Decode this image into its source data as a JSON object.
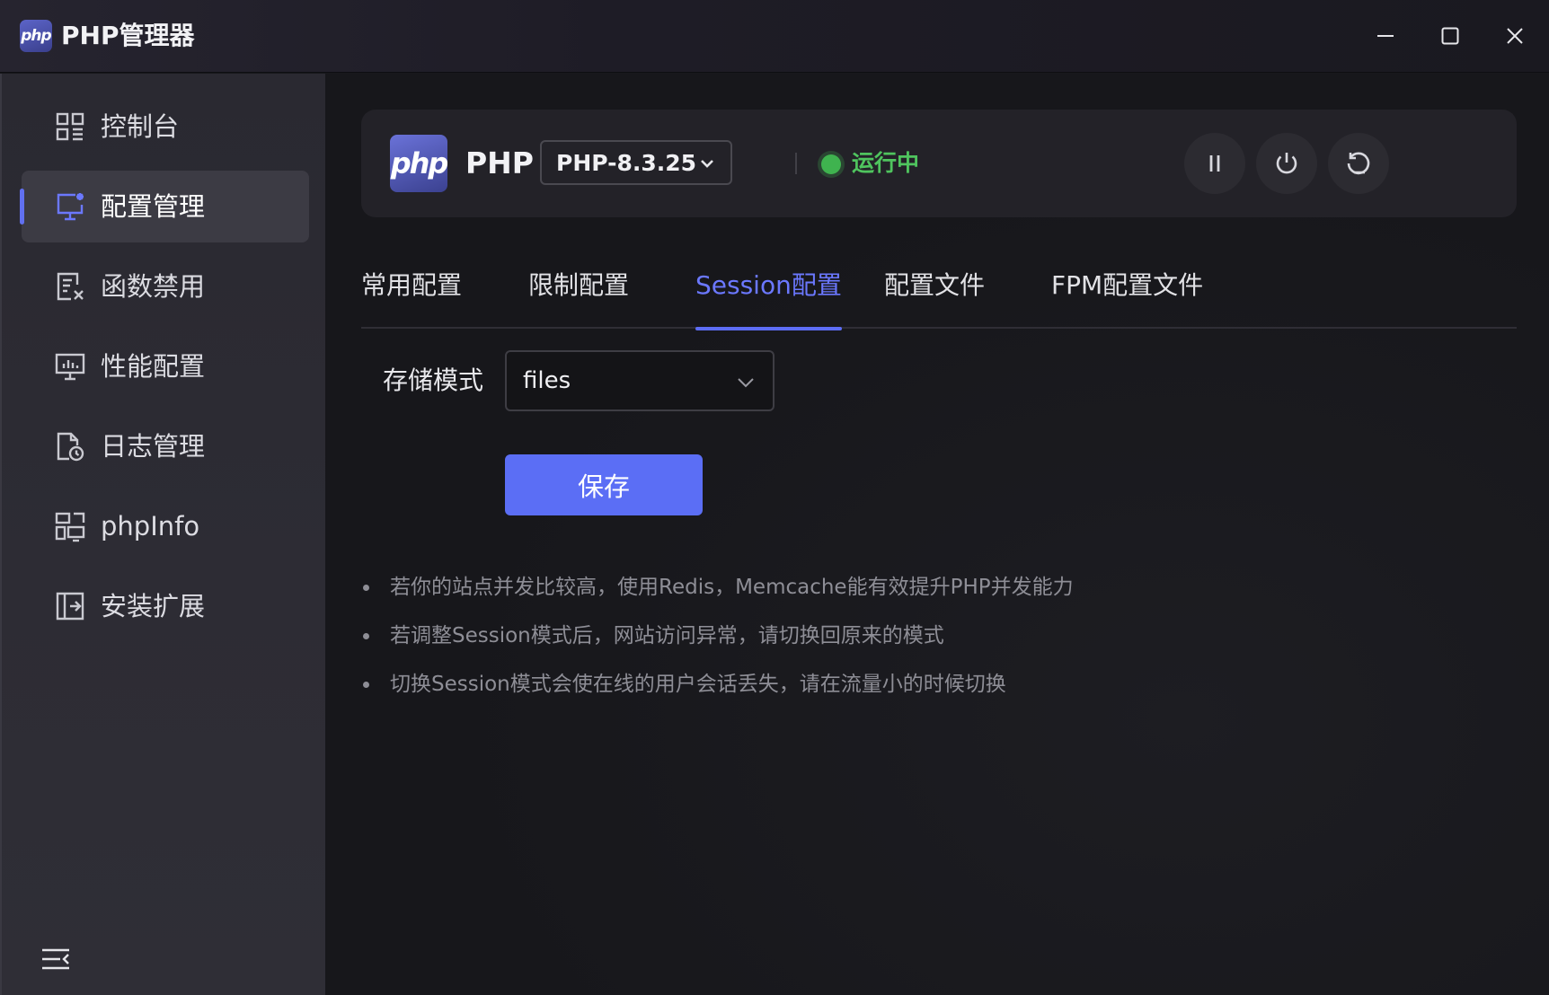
{
  "app": {
    "logo_text": "php",
    "title": "PHP管理器"
  },
  "window_controls": [
    "minimize-icon",
    "maximize-icon",
    "close-icon"
  ],
  "sidebar": {
    "items": [
      {
        "label": "控制台",
        "icon": "dashboard-icon",
        "active": false
      },
      {
        "label": "配置管理",
        "icon": "config-monitor-icon",
        "active": true
      },
      {
        "label": "函数禁用",
        "icon": "function-disable-icon",
        "active": false
      },
      {
        "label": "性能配置",
        "icon": "performance-icon",
        "active": false
      },
      {
        "label": "日志管理",
        "icon": "log-file-icon",
        "active": false
      },
      {
        "label": "phpInfo",
        "icon": "info-devices-icon",
        "active": false
      },
      {
        "label": "安装扩展",
        "icon": "extension-install-icon",
        "active": false
      }
    ],
    "collapse_icon": "menu-collapse-icon"
  },
  "header": {
    "logo_text": "php",
    "name": "PHP",
    "version": "PHP-8.3.25",
    "status": "运行中",
    "status_color": "#4fc45e",
    "actions": [
      "pause-icon",
      "power-icon",
      "restart-icon"
    ]
  },
  "tabs": [
    {
      "label": "常用配置",
      "active": false
    },
    {
      "label": "限制配置",
      "active": false
    },
    {
      "label": "Session配置",
      "active": true
    },
    {
      "label": "配置文件",
      "active": false
    },
    {
      "label": "FPM配置文件",
      "active": false
    }
  ],
  "form": {
    "storage_label": "存储模式",
    "storage_value": "files",
    "save_label": "保存"
  },
  "tips": [
    "若你的站点并发比较高，使用Redis，Memcache能有效提升PHP并发能力",
    "若调整Session模式后，网站访问异常，请切换回原来的模式",
    "切换Session模式会使在线的用户会话丢失，请在流量小的时候切换"
  ],
  "colors": {
    "accent": "#5b6ef5",
    "active_tab": "#6b78ff",
    "running": "#3fb34f"
  }
}
